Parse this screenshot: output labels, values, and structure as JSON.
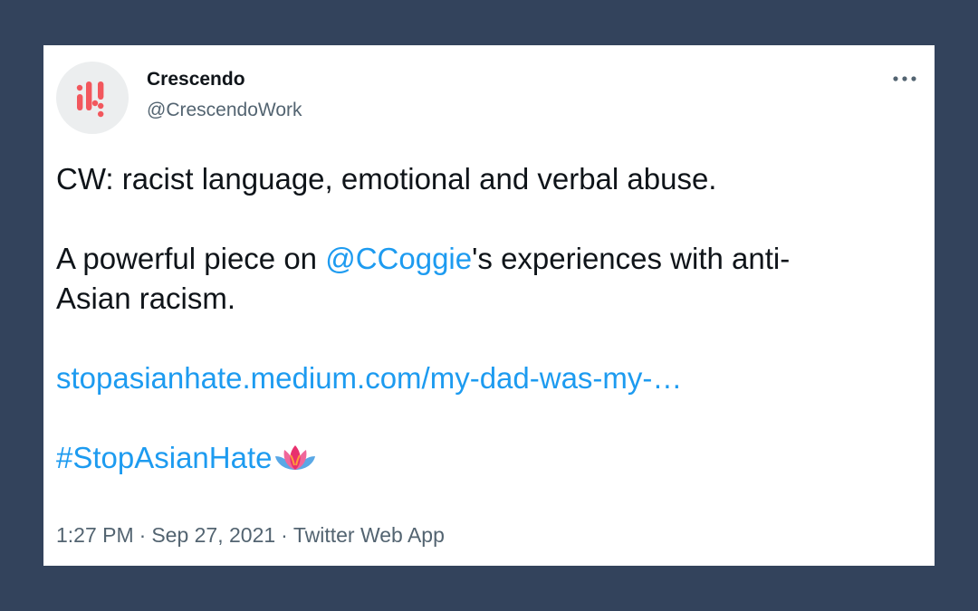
{
  "tweet": {
    "author": {
      "display_name": "Crescendo",
      "handle": "@CrescendoWork",
      "avatar_icon": "crescendo-logo-icon",
      "brand_color": "#f2575d"
    },
    "menu_icon": "more-options-icon",
    "content_warning": "CW: racist language, emotional and verbal abuse.",
    "body": {
      "prefix": "A powerful piece on ",
      "mention": "@CCoggie",
      "suffix_line1": "'s experiences with anti-",
      "suffix_line2": "Asian racism."
    },
    "link": "stopasianhate.medium.com/my-dad-was-my-…",
    "hashtag": "#StopAsianHate",
    "hashtag_emoji": "lotus-icon",
    "meta": {
      "time": "1:27 PM",
      "separator": "·",
      "date": "Sep 27, 2021",
      "source": "Twitter Web App"
    },
    "colors": {
      "link": "#1d9bf0",
      "text": "#0f1419",
      "secondary": "#536471",
      "background": "#33435c"
    }
  }
}
